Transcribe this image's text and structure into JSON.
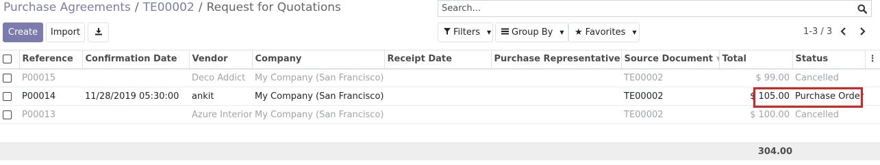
{
  "breadcrumb": {
    "items": [
      "Purchase Agreements",
      "TE00002"
    ],
    "separator": "/",
    "current": "Request for Quotations"
  },
  "search": {
    "placeholder": "Search..."
  },
  "buttons": {
    "create": "Create",
    "import": "Import"
  },
  "filters": {
    "filters_label": "Filters",
    "group_by_label": "Group By",
    "favorites_label": "Favorites"
  },
  "pager": {
    "value": "1-3 / 3"
  },
  "table": {
    "columns": [
      "Reference",
      "Confirmation Date",
      "Vendor",
      "Company",
      "Receipt Date",
      "Purchase Representative",
      "Source Document",
      "Total",
      "Status"
    ],
    "rows": [
      {
        "reference": "P00015",
        "confirmation_date": "",
        "vendor": "Deco Addict",
        "company": "My Company (San Francisco)",
        "receipt_date": "",
        "purchase_rep": "",
        "source_document": "TE00002",
        "total": "$ 99.00",
        "status": "Cancelled",
        "muted": true
      },
      {
        "reference": "P00014",
        "confirmation_date": "11/28/2019 05:30:00",
        "vendor": "ankit",
        "company": "My Company (San Francisco)",
        "receipt_date": "",
        "purchase_rep": "",
        "source_document": "TE00002",
        "total": "$ 105.00",
        "status": "Purchase Order",
        "muted": false
      },
      {
        "reference": "P00013",
        "confirmation_date": "",
        "vendor": "Azure Interior",
        "company": "My Company (San Francisco)",
        "receipt_date": "",
        "purchase_rep": "",
        "source_document": "TE00002",
        "total": "$ 100.00",
        "status": "Cancelled",
        "muted": true
      }
    ],
    "footer_total": "304.00"
  },
  "colors": {
    "primary": "#7c7bad",
    "highlight": "#e21f1f",
    "muted_text": "#a0a4a8"
  }
}
